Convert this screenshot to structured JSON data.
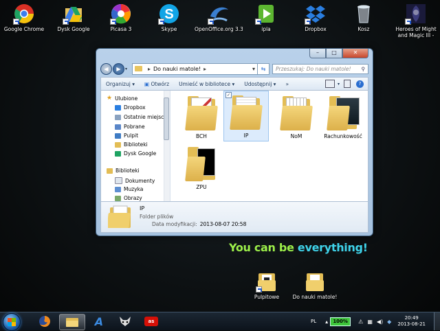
{
  "desktop": {
    "icons": [
      {
        "label": "Google Chrome"
      },
      {
        "label": "Dysk Google"
      },
      {
        "label": "Picasa 3"
      },
      {
        "label": "Skype"
      },
      {
        "label": "OpenOffice.org 3.3"
      },
      {
        "label": "ipla"
      },
      {
        "label": "Dropbox"
      },
      {
        "label": "Kosz"
      },
      {
        "label": "Heroes of Might and Magic III - Złota Ed..."
      }
    ],
    "bottom_icons": [
      {
        "label": "Pulpitowe"
      },
      {
        "label": "Do nauki matole!"
      }
    ],
    "slogan_part1": "You can be ",
    "slogan_part2": "everything!"
  },
  "explorer": {
    "address": {
      "folder": "Do nauki matole!",
      "separator": "▸"
    },
    "search_placeholder": "Przeszukaj: Do nauki matole!",
    "toolbar": {
      "organize": "Organizuj ▾",
      "open": "Otwórz",
      "include_library": "Umieść w bibliotece ▾",
      "share": "Udostępnij ▾",
      "more": "»"
    },
    "nav": {
      "favorites_header": "Ulubione",
      "favorites": [
        "Dropbox",
        "Ostatnie miejsca",
        "Pobrane",
        "Pulpit",
        "Biblioteki",
        "Dysk Google"
      ],
      "libraries_header": "Biblioteki",
      "libraries": [
        "Dokumenty",
        "Muzyka",
        "Obrazy"
      ]
    },
    "files": [
      {
        "name": "BCH",
        "selected": false
      },
      {
        "name": "IP",
        "selected": true
      },
      {
        "name": "NoM",
        "selected": false
      },
      {
        "name": "Rachunkowość",
        "selected": false
      },
      {
        "name": "ZPU",
        "selected": false
      }
    ],
    "details": {
      "name": "IP",
      "type": "Folder plików",
      "modified_label": "Data modyfikacji:",
      "modified_value": "2013-08-07 20:58"
    }
  },
  "taskbar": {
    "language": "PL",
    "battery": "100%",
    "time": "20:49",
    "date": "2013-08-21"
  },
  "colors": {
    "slogan_green": "#9df04a",
    "slogan_cyan": "#3fd3ea",
    "folder": "#e3bd55",
    "window_frame": "#b9d1ea"
  }
}
